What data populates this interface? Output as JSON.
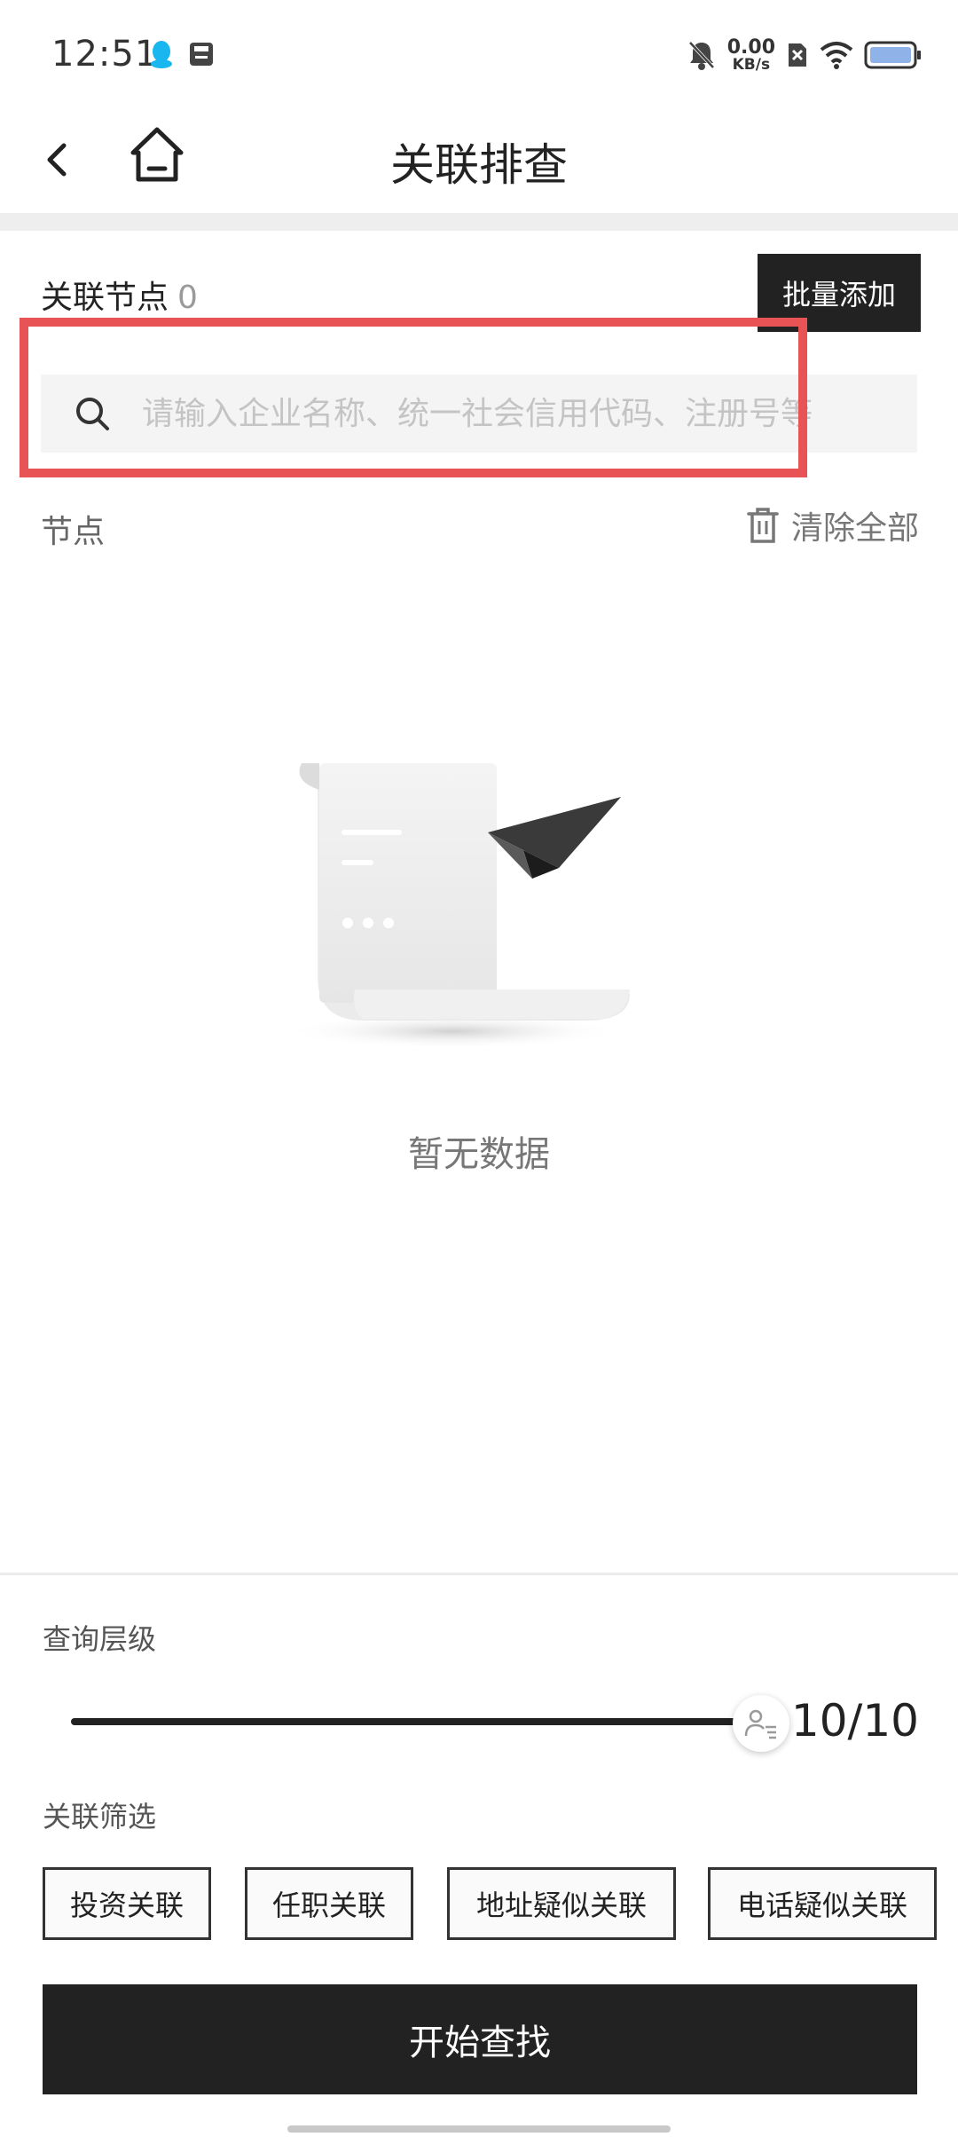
{
  "status_bar": {
    "time": "12:51",
    "net_speed_value": "0.00",
    "net_speed_unit": "KB/s",
    "icons": [
      "qq-icon",
      "save-icon",
      "mute-bell-icon",
      "sim-x-icon",
      "wifi-icon",
      "battery-icon"
    ]
  },
  "nav": {
    "title": "关联排查"
  },
  "nodes": {
    "label": "关联节点",
    "count": "0",
    "batch_add_label": "批量添加"
  },
  "search": {
    "placeholder": "请输入企业名称、统一社会信用代码、注册号等",
    "value": ""
  },
  "list_header": {
    "label": "节点",
    "clear_label": "清除全部"
  },
  "empty_state": {
    "text": "暂无数据"
  },
  "query_level": {
    "label": "查询层级",
    "value_text": "10/10",
    "current": 10,
    "max": 10
  },
  "filters": {
    "label": "关联筛选",
    "chips": [
      "投资关联",
      "任职关联",
      "地址疑似关联",
      "电话疑似关联"
    ]
  },
  "start_button_label": "开始查找",
  "colors": {
    "accent_dark": "#222222",
    "highlight_red": "#e85456",
    "search_bg": "#f4f4f4"
  }
}
